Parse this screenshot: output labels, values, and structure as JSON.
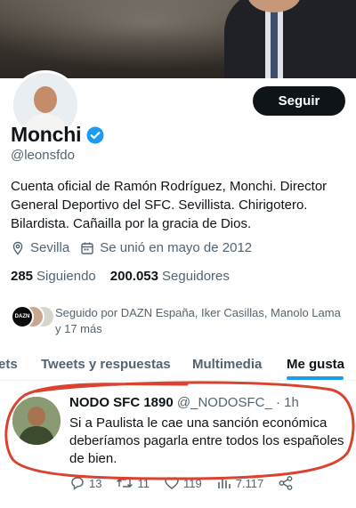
{
  "profile": {
    "display_name": "Monchi",
    "handle": "@leonsfdo",
    "follow_label": "Seguir",
    "bio": "Cuenta oficial de Ramón Rodríguez, Monchi. Director General Deportivo del SFC. Sevillista. Chirigotero. Bilardista. Cañailla por la gracia de Dios.",
    "location": "Sevilla",
    "joined": "Se unió en mayo de 2012",
    "following_count": "285",
    "following_label": "Siguiendo",
    "followers_count": "200.053",
    "followers_label": "Seguidores",
    "followed_by": "Seguido por DAZN España, Iker Casillas, Manolo Lama y 17 más",
    "dazn_avatar_text": "DAZN"
  },
  "tabs": [
    {
      "label": "ets"
    },
    {
      "label": "Tweets y respuestas"
    },
    {
      "label": "Multimedia"
    },
    {
      "label": "Me gusta"
    }
  ],
  "tweet": {
    "author": "NODO SFC 1890",
    "handle": "@_NODOSFC_",
    "separator": " · ",
    "time": "1h",
    "text": "Si a Paulista le cae una sanción económica deberíamos pagarla entre todos los españoles de bien.",
    "replies": "13",
    "retweets": "11",
    "likes": "119",
    "views": "7.117"
  },
  "colors": {
    "accent": "#1d9bf0",
    "text": "#0f1419",
    "secondary": "#536471",
    "annotation": "#d9432f"
  },
  "icons": [
    "verified-badge-icon",
    "location-pin-icon",
    "calendar-icon",
    "reply-icon",
    "retweet-icon",
    "like-heart-icon",
    "views-icon",
    "share-icon"
  ]
}
